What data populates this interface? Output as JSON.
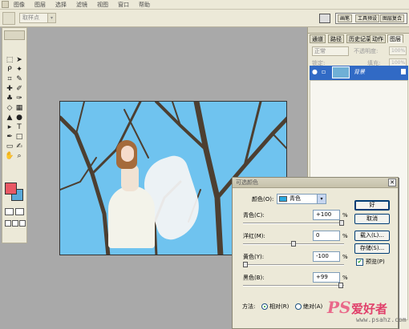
{
  "menubar": {
    "items": [
      "图像",
      "图层",
      "选择",
      "滤镜",
      "视图",
      "窗口",
      "帮助"
    ]
  },
  "options": {
    "preset": "取样点",
    "wells": [
      "画笔",
      "工具预设",
      "图层复合"
    ]
  },
  "panels": {
    "tabs": [
      "通道",
      "路径",
      "历史记录",
      "动作",
      "图层"
    ],
    "blend_mode": "正常",
    "opacity_label": "不透明度:",
    "opacity_value": "100%",
    "lock_label": "锁定:",
    "fill_label": "填充:",
    "fill_value": "100%",
    "layer_name": "背景"
  },
  "dialog": {
    "title": "可选颜色",
    "colors_label": "颜色(O):",
    "colors_value": "青色",
    "sliders": [
      {
        "label": "青色(C):",
        "value": "+100",
        "unit": "%",
        "level": 1.0
      },
      {
        "label": "洋红(M):",
        "value": "0",
        "unit": "%",
        "level": 0.5
      },
      {
        "label": "黄色(Y):",
        "value": "-100",
        "unit": "%",
        "level": 0.0
      },
      {
        "label": "黑色(B):",
        "value": "+99",
        "unit": "%",
        "level": 0.995
      }
    ],
    "buttons": {
      "ok": "好",
      "cancel": "取消",
      "load": "载入(L)...",
      "save": "存储(S)..."
    },
    "preview_label": "预览(P)",
    "method_label": "方法:",
    "relative_label": "相对(R)",
    "absolute_label": "绝对(A)"
  },
  "watermark": {
    "brand": "PS",
    "brand_cn": "爱好者",
    "url": "www.psahz.com"
  },
  "colors": {
    "foreground": "#e95864",
    "background": "#5aa9d8",
    "selection": "#316ac5"
  }
}
